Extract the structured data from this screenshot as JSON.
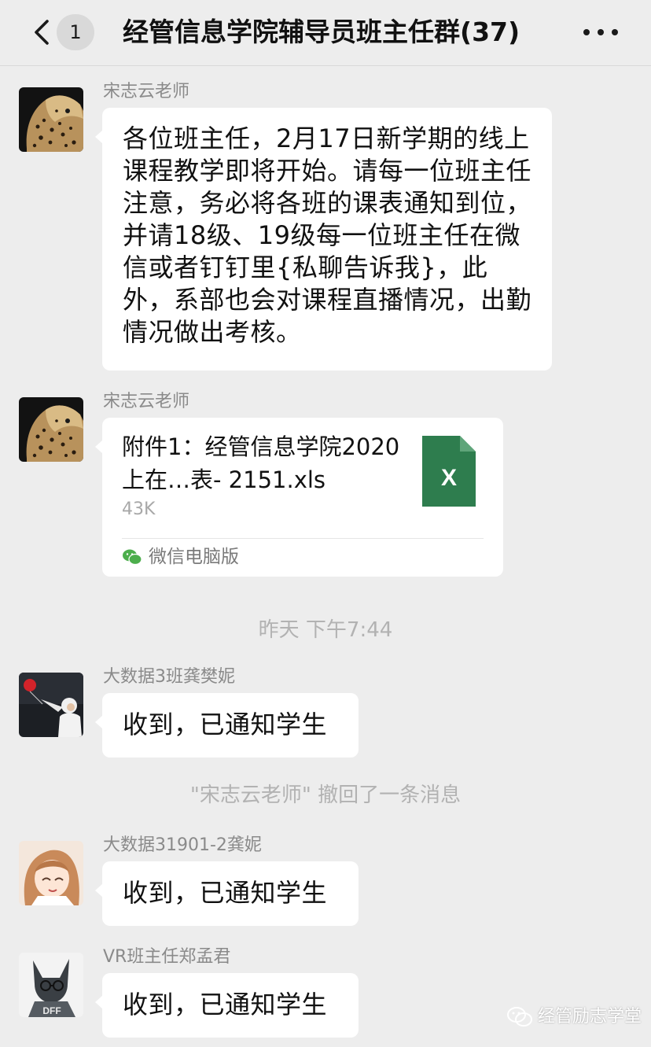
{
  "header": {
    "unread_count": "1",
    "title": "经管信息学院辅导员班主任群(37)"
  },
  "messages": [
    {
      "sender": "宋志云老师",
      "text": "各位班主任，2月17日新学期的线上课程教学即将开始。请每一位班主任注意，务必将各班的课表通知到位，并请18级、19级每一位班主任在微信或者钉钉里{私聊告诉我}，此外，系部也会对课程直播情况，出勤情况做出考核。"
    },
    {
      "sender": "宋志云老师",
      "file": {
        "name": "附件1：经管信息学院2020上在…表- 2151.xls",
        "size": "43K",
        "icon_letter": "X",
        "source": "微信电脑版"
      }
    },
    {
      "sender": "大数据3班龚樊妮",
      "text": "收到，已通知学生"
    },
    {
      "sender": "大数据31901-2龚妮",
      "text": "收到，已通知学生"
    },
    {
      "sender": "VR班主任郑孟君",
      "text": "收到，已通知学生"
    }
  ],
  "system": {
    "time": "昨天 下午7:44",
    "recall": "\"宋志云老师\" 撤回了一条消息"
  },
  "watermark": "经管励志学堂",
  "colors": {
    "background": "#ededed",
    "bubble": "#ffffff",
    "excel_green": "#2e7d4e",
    "wechat_green": "#4cae4c"
  }
}
